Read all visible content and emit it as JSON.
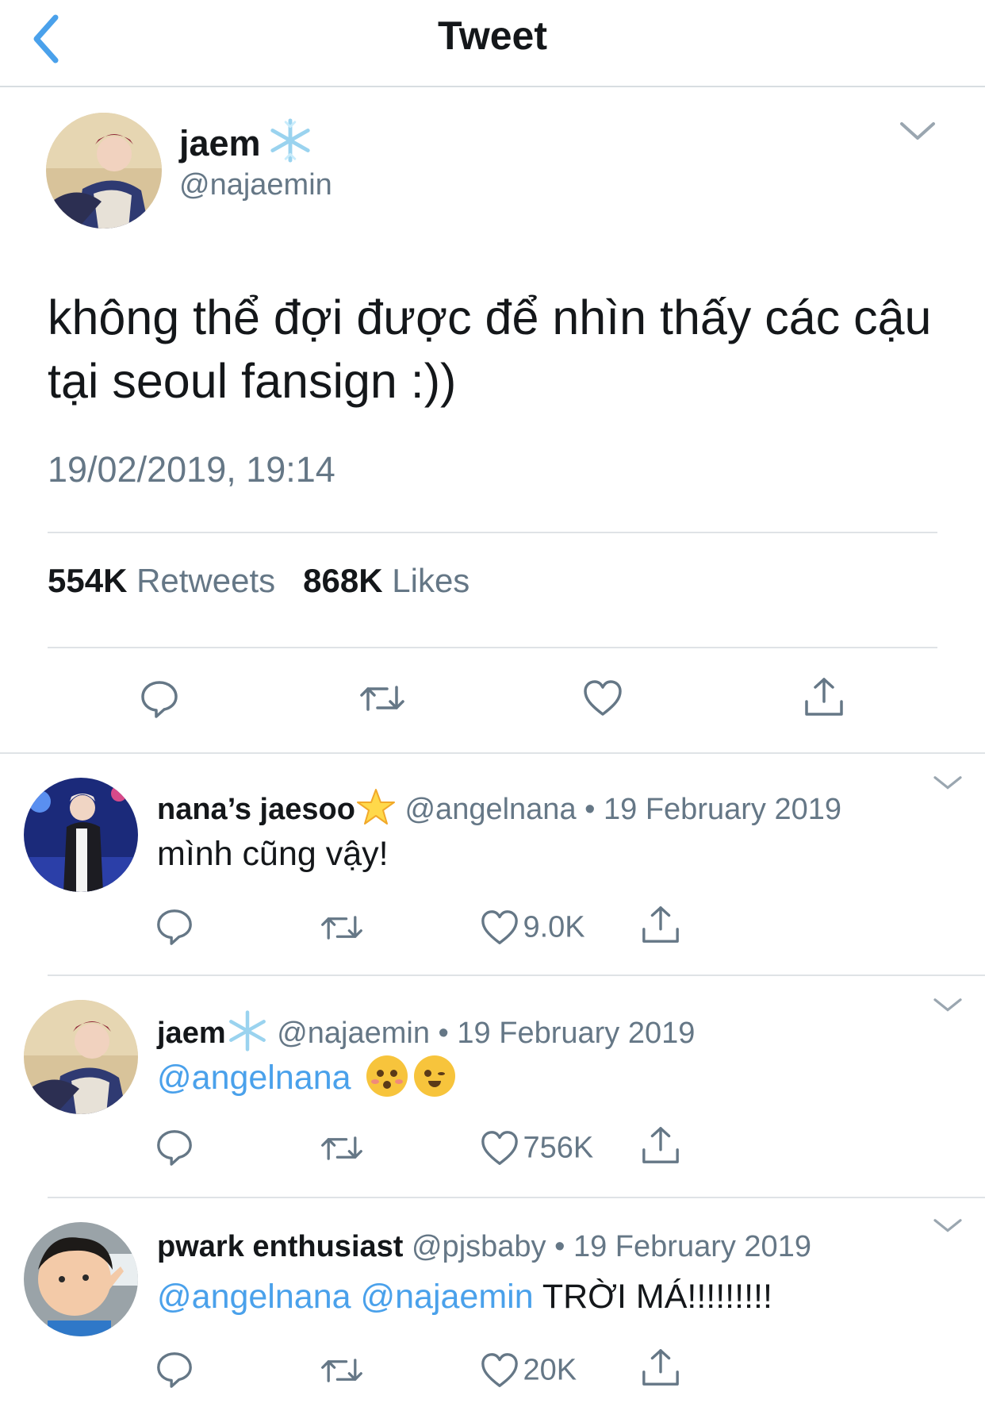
{
  "header": {
    "title": "Tweet",
    "back_icon": "chevron-left-icon"
  },
  "tweet": {
    "display_name": "jaem",
    "name_emoji": "snowflake-icon",
    "handle": "@najaemin",
    "text": "không thể đợi được để nhìn thấy các cậu tại seoul fansign :))",
    "timestamp": "19/02/2019, 19:14",
    "retweets_count": "554K",
    "retweets_label": "Retweets",
    "likes_count": "868K",
    "likes_label": "Likes",
    "actions": [
      "reply-icon",
      "retweet-icon",
      "like-icon",
      "share-icon"
    ]
  },
  "replies": [
    {
      "display_name": "nana’s jaesoo",
      "name_emoji": "star-icon",
      "handle": "@angelnana",
      "dot": "•",
      "date": "19 February 2019",
      "text": "mình cũng vậy!",
      "like_count": "9.0K"
    },
    {
      "display_name": "jaem",
      "name_emoji": "snowflake-icon",
      "handle": "@najaemin",
      "dot": "•",
      "date": "19 February 2019",
      "mention1": "@angelnana",
      "emojis": [
        "kissing-face-icon",
        "winking-face-icon"
      ],
      "like_count": "756K"
    },
    {
      "display_name": "pwark enthusiast",
      "handle": "@pjsbaby",
      "dot": "•",
      "date": "19 February 2019",
      "mention1": "@angelnana",
      "mention2": "@najaemin",
      "text": "TRỜI MÁ!!!!!!!!!",
      "like_count": "20K"
    }
  ],
  "colors": {
    "accent": "#4aa1eb",
    "muted": "#657786",
    "text": "#14171a",
    "divider": "#dfe3e6"
  }
}
